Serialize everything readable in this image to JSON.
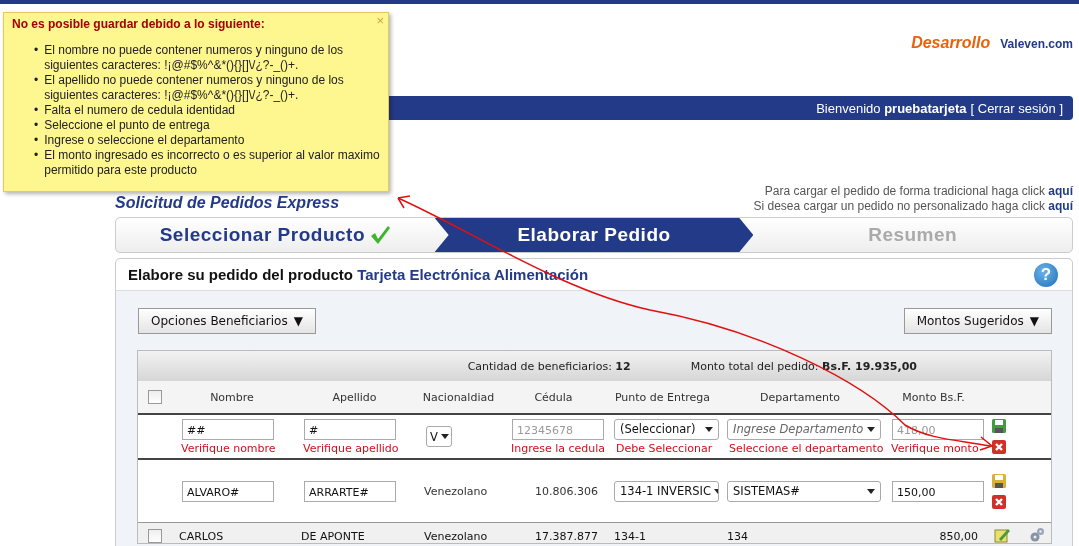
{
  "error_tooltip": {
    "title": "No es posible guardar debido a lo siguiente:",
    "close": "×",
    "bullet": "•",
    "messages": [
      "El nombre no puede contener numeros y ninguno de los siguientes caracteres: !¡@#$%^&*(){}[]\\/¿?-_()+.",
      "El apellido no puede contener numeros y ninguno de los siguientes caracteres: !¡@#$%^&*(){}[]\\/¿?-_()+.",
      "Falta el numero de cedula identidad",
      "Seleccione el punto de entrega",
      "Ingrese o seleccione el departamento",
      "El monto ingresado es incorrecto o es superior al valor maximo permitido para este producto"
    ]
  },
  "brand": {
    "environment": "Desarrollo",
    "site": "Valeven.com"
  },
  "welcome_bar": {
    "greeting": "Bienvenido",
    "user": "pruebatarjeta",
    "logout": "[ Cerrar sesión ]"
  },
  "page_title": "Solicitud de Pedidos Express",
  "load_links": [
    {
      "text": "Para cargar el pedido de forma tradicional haga click",
      "link": "aquí"
    },
    {
      "text": "Si desea cargar un pedido no personalizado haga click",
      "link": "aquí"
    }
  ],
  "steps": [
    {
      "label": "Seleccionar Producto",
      "completed": true,
      "selected": false
    },
    {
      "label": "Elaborar Pedido",
      "completed": false,
      "selected": true
    },
    {
      "label": "Resumen",
      "completed": false,
      "selected": false
    }
  ],
  "panel": {
    "title": "Elabore su pedido del producto",
    "product": "Tarjeta Electrónica Alimentación",
    "help": "?",
    "buttons": [
      {
        "label": "Opciones Beneficiarios",
        "caret": "▼"
      },
      {
        "label": "Montos Sugeridos",
        "caret": "▼"
      }
    ]
  },
  "table": {
    "summary": [
      {
        "label": "Cantidad de beneficiarios:",
        "value": "12"
      },
      {
        "label": "Monto total del pedido:",
        "value": "Bs.F. 19.935,00"
      }
    ],
    "columns": [
      {
        "kind": "checkbox",
        "checked": false
      },
      {
        "label": "Nombre"
      },
      {
        "label": "Apellido"
      },
      {
        "label": "Nacionaldiad"
      },
      {
        "label": "Cédula"
      },
      {
        "label": "Punto de Entrega"
      },
      {
        "label": "Departamento"
      },
      {
        "label": "Monto Bs.F."
      }
    ],
    "rows": [
      {
        "kind": "editing",
        "cells": [
          {
            "kind": "empty"
          },
          {
            "kind": "input",
            "value": "##",
            "error": "Verifique nombre"
          },
          {
            "kind": "input",
            "value": "#",
            "error": "Verifique apellido"
          },
          {
            "kind": "select",
            "value": "V",
            "small": true
          },
          {
            "kind": "input",
            "placeholder": "12345678",
            "error": "Ingrese la cedula"
          },
          {
            "kind": "select",
            "value": "(Seleccionar)",
            "error": "Debe Seleccionar"
          },
          {
            "kind": "select",
            "placeholder": "Ingrese Departamento",
            "error": "Seleccione el departamento"
          },
          {
            "kind": "input",
            "placeholder": "418,00",
            "error": "Verifique monto"
          },
          {
            "kind": "actions",
            "color": "#3f9e3a"
          },
          {
            "kind": "empty"
          }
        ]
      },
      {
        "kind": "editing",
        "cells": [
          {
            "kind": "empty"
          },
          {
            "kind": "input",
            "value": "ALVARO#"
          },
          {
            "kind": "input",
            "value": "ARRARTE#"
          },
          {
            "kind": "text",
            "value": "Venezolano"
          },
          {
            "kind": "number",
            "value": "10.806.306"
          },
          {
            "kind": "select",
            "value": "134-1 INVERSIC"
          },
          {
            "kind": "select",
            "value": "SISTEMAS#"
          },
          {
            "kind": "input",
            "value": "150,00"
          },
          {
            "kind": "actions",
            "color": "#d9b13a"
          },
          {
            "kind": "empty"
          }
        ]
      },
      {
        "kind": "view",
        "cells": [
          {
            "kind": "checkbox",
            "checked": false
          },
          {
            "kind": "text",
            "value": "CARLOS"
          },
          {
            "kind": "text",
            "value": "DE APONTE"
          },
          {
            "kind": "text",
            "value": "Venezolano"
          },
          {
            "kind": "number",
            "value": "17.387.877"
          },
          {
            "kind": "text",
            "value": "134-1"
          },
          {
            "kind": "text",
            "value": "134"
          },
          {
            "kind": "number",
            "value": "850,00"
          },
          {
            "kind": "edit"
          },
          {
            "kind": "gear"
          }
        ]
      }
    ]
  }
}
